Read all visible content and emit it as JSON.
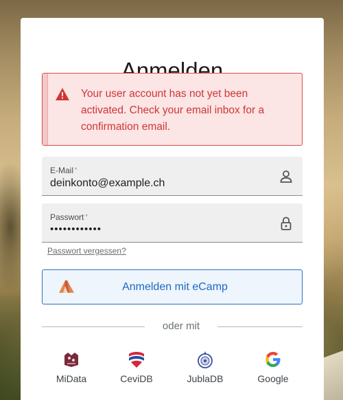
{
  "login": {
    "title": "Anmelden",
    "alert": {
      "icon": "warning-icon",
      "message": "Your user account has not yet been activated. Check your email inbox for a confirmation email.",
      "color": "#d03535"
    },
    "email": {
      "label": "E-Mail",
      "required_mark": "*",
      "value": "deinkonto@example.ch",
      "icon": "person-icon"
    },
    "password": {
      "label": "Passwort",
      "required_mark": "*",
      "value": "••••••••••••",
      "icon": "lock-icon"
    },
    "forgot_password": "Passwort vergessen?",
    "ecamp_button": {
      "label": "Anmelden mit eCamp",
      "icon": "ecamp-tent-icon",
      "accent": "#1d69c0"
    },
    "divider_text": "oder mit",
    "providers": [
      {
        "label": "MiData",
        "icon": "midata-icon"
      },
      {
        "label": "CeviDB",
        "icon": "cevidb-icon"
      },
      {
        "label": "JublaDB",
        "icon": "jubladb-icon"
      },
      {
        "label": "Google",
        "icon": "google-icon"
      }
    ]
  }
}
